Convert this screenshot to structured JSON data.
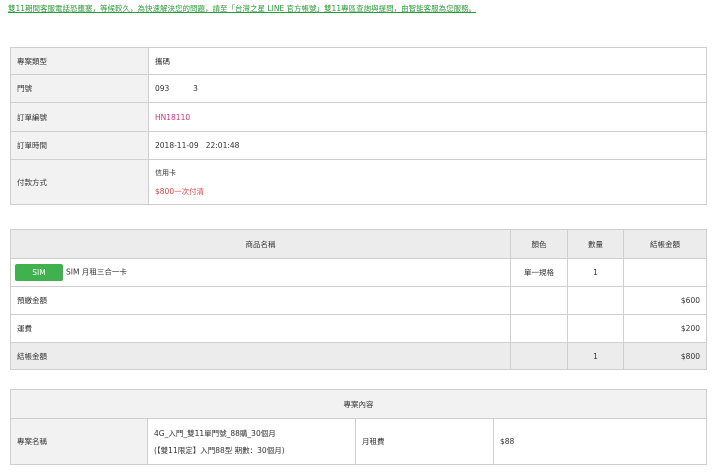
{
  "notice": "雙11期間客服電話恐壅塞，等候較久，為快速解決您的問題，請至「台灣之星 LINE 官方帳號」雙11專區查詢與提問，由智能客服為您服務。",
  "info": {
    "rows": [
      {
        "label": "專案類型",
        "value": "攜碼"
      },
      {
        "label": "門號",
        "value": "093          3"
      },
      {
        "label": "訂單編號",
        "value": "HN18110"
      },
      {
        "label": "訂單時間",
        "value": "2018-11-09   22:01:48"
      }
    ],
    "payment": {
      "label": "付款方式",
      "method": "信用卡",
      "amount": "$800一次付清"
    }
  },
  "products": {
    "headers": [
      "商品名稱",
      "顏色",
      "數量",
      "結帳金額"
    ],
    "item": {
      "badge": "SIM",
      "name": "SIM 月租三合一卡",
      "color": "單一規格",
      "qty": "1",
      "amount": ""
    },
    "prepay": {
      "label": "預繳金額",
      "amount": "$600"
    },
    "shipping": {
      "label": "運費",
      "amount": "$200"
    },
    "total": {
      "label": "結帳金額",
      "qty": "1",
      "amount": "$800"
    }
  },
  "plan": {
    "title": "專案內容",
    "name_label": "專案名稱",
    "name_line1": "4G_入門_雙11單門號_88購_30個月",
    "name_line2": "(【雙11限定】入門88型 期數：30個月)",
    "fee_label": "月租費",
    "fee_value": "$88"
  }
}
